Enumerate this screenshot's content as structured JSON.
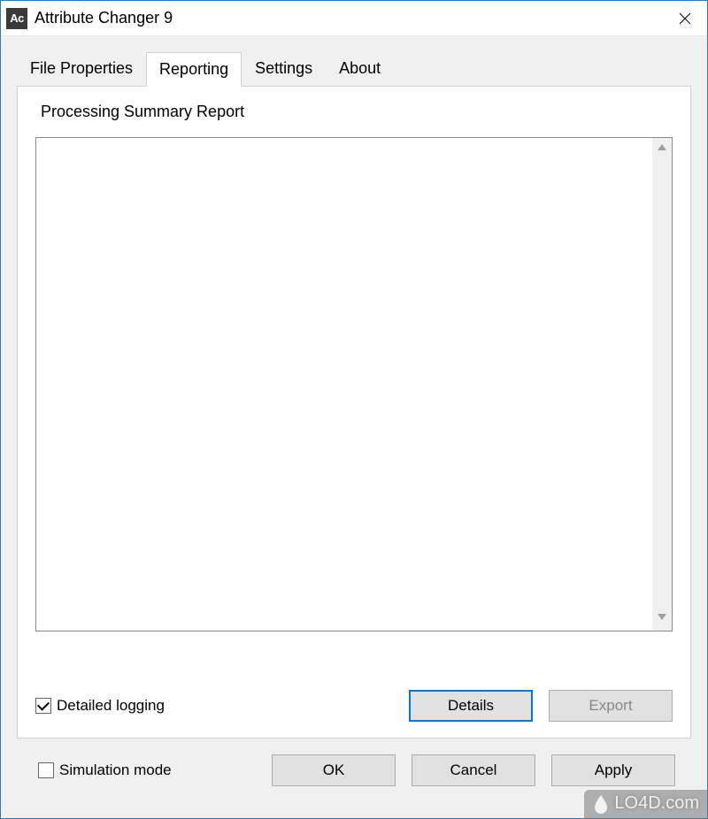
{
  "window": {
    "title": "Attribute Changer 9",
    "appIconText": "Ac"
  },
  "tabs": {
    "items": [
      {
        "label": "File Properties",
        "active": false
      },
      {
        "label": "Reporting",
        "active": true
      },
      {
        "label": "Settings",
        "active": false
      },
      {
        "label": "About",
        "active": false
      }
    ]
  },
  "panel": {
    "heading": "Processing Summary Report",
    "detailedLogging": {
      "label": "Detailed logging",
      "checked": true
    },
    "buttons": {
      "details": "Details",
      "export": "Export"
    }
  },
  "bottom": {
    "simulationMode": {
      "label": "Simulation mode",
      "checked": false
    },
    "buttons": {
      "ok": "OK",
      "cancel": "Cancel",
      "apply": "Apply"
    }
  },
  "watermark": {
    "text": "LO4D.com"
  }
}
